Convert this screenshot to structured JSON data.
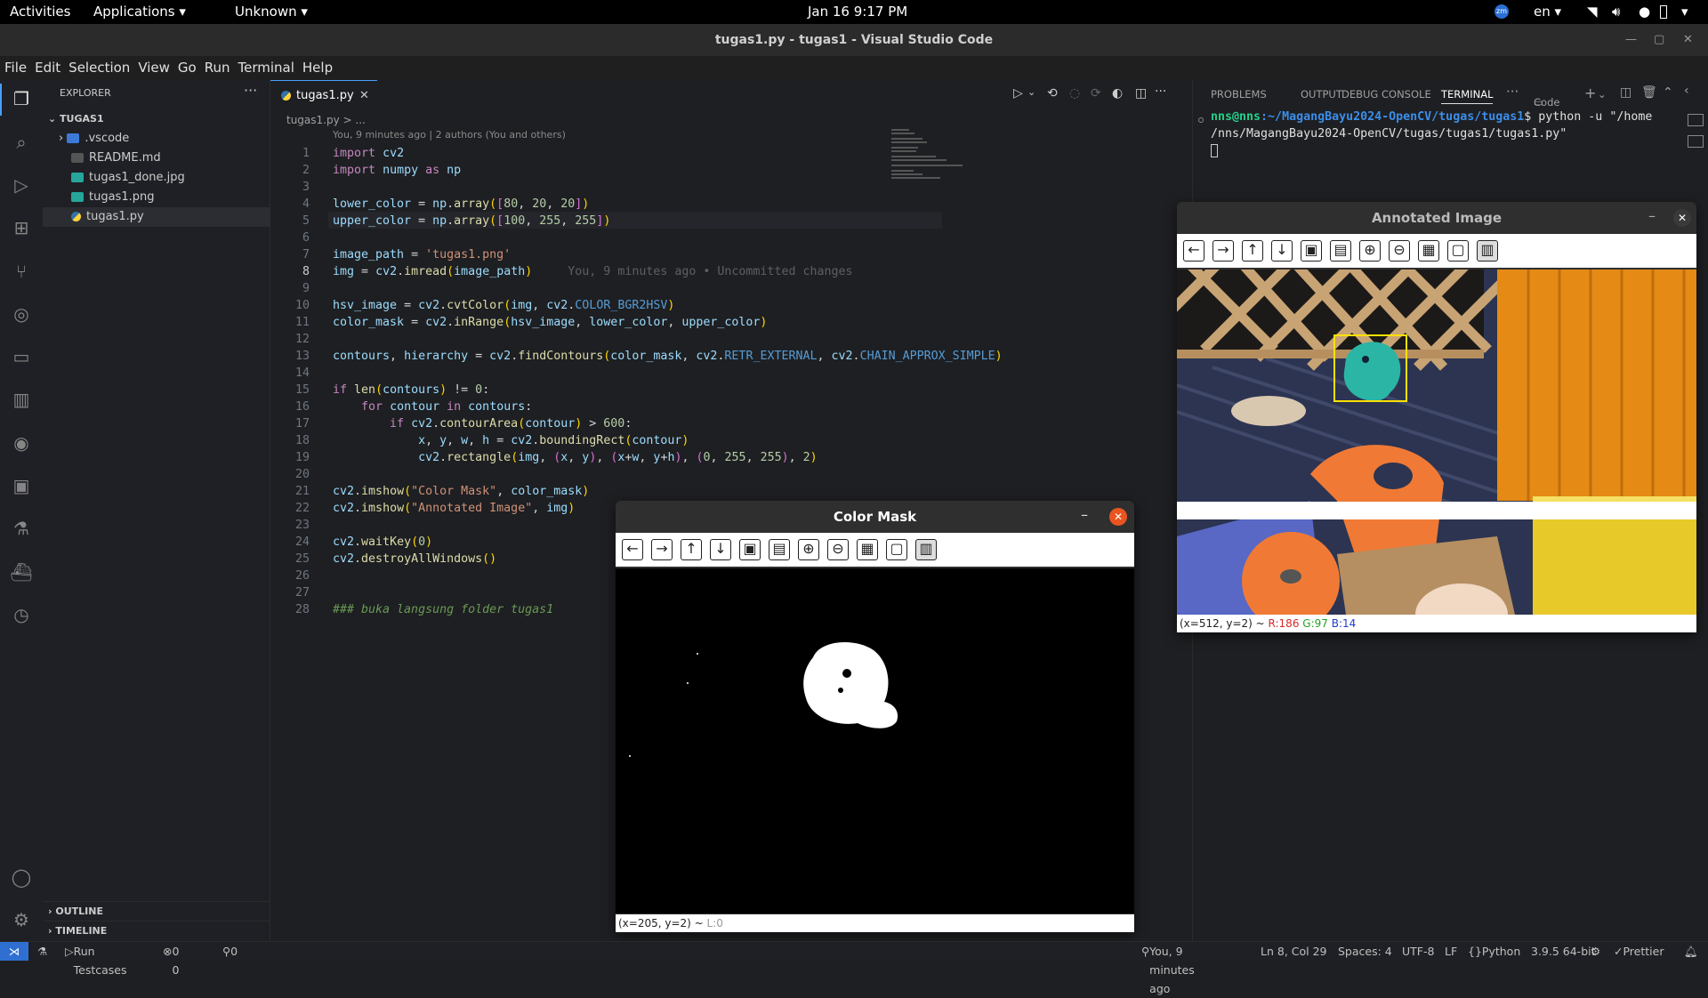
{
  "topbar": {
    "activities": "Activities",
    "applications": "Applications",
    "unknown": "Unknown",
    "datetime": "Jan 16  9:17 PM",
    "lang": "en"
  },
  "window": {
    "title": "tugas1.py - tugas1 - Visual Studio Code"
  },
  "menu": [
    "File",
    "Edit",
    "Selection",
    "View",
    "Go",
    "Run",
    "Terminal",
    "Help"
  ],
  "explorer": {
    "header": "EXPLORER",
    "folder": "TUGAS1",
    "items": [
      ".vscode",
      "README.md",
      "tugas1_done.jpg",
      "tugas1.png",
      "tugas1.py"
    ],
    "outline": "OUTLINE",
    "timeline": "TIMELINE"
  },
  "editor": {
    "tab": "tugas1.py",
    "breadcrumb": "tugas1.py > ...",
    "blame_header": "You, 9 minutes ago | 2 authors (You and others)",
    "inline_blame": "You, 9 minutes ago • Uncommitted changes",
    "lines": [
      "import cv2",
      "import numpy as np",
      "",
      "lower_color = np.array([80, 20, 20])",
      "upper_color = np.array([100, 255, 255])",
      "",
      "image_path = 'tugas1.png'",
      "img = cv2.imread(image_path)",
      "",
      "hsv_image = cv2.cvtColor(img, cv2.COLOR_BGR2HSV)",
      "color_mask = cv2.inRange(hsv_image, lower_color, upper_color)",
      "",
      "contours, hierarchy = cv2.findContours(color_mask, cv2.RETR_EXTERNAL, cv2.CHAIN_APPROX_SIMPLE)",
      "",
      "if len(contours) != 0:",
      "    for contour in contours:",
      "        if cv2.contourArea(contour) > 600:",
      "            x, y, w, h = cv2.boundingRect(contour)",
      "            cv2.rectangle(img, (x, y), (x+w, y+h), (0, 255, 255), 2)",
      "",
      "cv2.imshow(\"Color Mask\", color_mask)",
      "cv2.imshow(\"Annotated Image\", img)",
      "",
      "cv2.waitKey(0)",
      "cv2.destroyAllWindows()",
      "",
      "",
      "### buka langsung folder tugas1"
    ]
  },
  "panel": {
    "tabs": [
      "PROBLEMS",
      "OUTPUT",
      "DEBUG CONSOLE",
      "TERMINAL"
    ],
    "code_label": "Code",
    "prompt_user": "nns@nns",
    "prompt_path": ":~/MagangBayu2024-OpenCV/tugas/tugas1",
    "command": "$ python -u \"/home",
    "command_cont": "/nns/MagangBayu2024-OpenCV/tugas/tugas1/tugas1.py\""
  },
  "mask_window": {
    "title": "Color Mask",
    "status": "(x=205, y=2) ~ ",
    "status_value": "L:0"
  },
  "annot_window": {
    "title": "Annotated Image",
    "status_prefix": "(x=512, y=2) ~ ",
    "r": "R:186",
    "g": "G:97",
    "b": "B:14"
  },
  "statusbar": {
    "run_testcases": "Run Testcases",
    "problems": "0 0",
    "ports": "0",
    "blame": "You, 9 minutes ago",
    "cursor": "Ln 8, Col 29",
    "spaces": "Spaces: 4",
    "encoding": "UTF-8",
    "eol": "LF",
    "language": "Python",
    "interpreter": "3.9.5 64-bit",
    "prettier": "Prettier"
  },
  "colors": {
    "accent": "#4a9eff",
    "box_yellow": "#ffe000",
    "terminal_green": "#23d18b",
    "terminal_blue": "#3b8eea"
  }
}
